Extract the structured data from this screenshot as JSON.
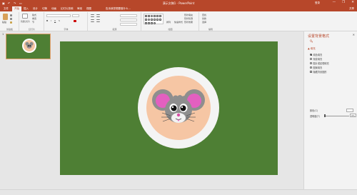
{
  "window": {
    "title": "演示文稿1 - PowerPoint",
    "signin": "登录",
    "minimize": "—",
    "restore": "❐",
    "close": "✕",
    "quick_access": [
      "save-icon",
      "undo-icon",
      "redo-icon",
      "present-icon"
    ]
  },
  "tabs": [
    {
      "label": "文件",
      "active": false
    },
    {
      "label": "开始",
      "active": true
    },
    {
      "label": "插入",
      "active": false
    },
    {
      "label": "设计",
      "active": false
    },
    {
      "label": "切换",
      "active": false
    },
    {
      "label": "动画",
      "active": false
    },
    {
      "label": "幻灯片放映",
      "active": false
    },
    {
      "label": "审阅",
      "active": false
    },
    {
      "label": "视图",
      "active": false
    }
  ],
  "tell_me": "告诉我您想要做什么...",
  "share": "共享",
  "ribbon": {
    "groups": [
      {
        "label": "剪贴板"
      },
      {
        "label": "幻灯片"
      },
      {
        "label": "字体"
      },
      {
        "label": "段落"
      },
      {
        "label": "绘图"
      },
      {
        "label": "编辑"
      }
    ],
    "paste": "粘贴",
    "new_slide": "新建幻灯片",
    "layout": "版式",
    "reset": "重置",
    "section": "节",
    "arrange": "排列",
    "quick_styles": "快速样式",
    "shape_fill": "形状填充",
    "shape_outline": "形状轮廓",
    "shape_effects": "形状效果",
    "find": "查找",
    "replace": "替换",
    "select": "选择"
  },
  "thumbnails": [
    {
      "number": "1",
      "selected": true
    }
  ],
  "format_pane": {
    "title": "设置背景格式",
    "close": "✕",
    "section": "▲ 填充",
    "options": [
      {
        "label": "纯色填充",
        "selected": true
      },
      {
        "label": "渐变填充",
        "selected": false
      },
      {
        "label": "图片或纹理填充",
        "selected": false
      },
      {
        "label": "图案填充",
        "selected": false
      },
      {
        "label": "隐藏背景图形",
        "selected": false
      }
    ],
    "color_label": "颜色(C)",
    "transparency_label": "透明度(T)",
    "transparency_value": "0%",
    "transparency": 0
  },
  "slide": {
    "background_color": "#4e7f34"
  },
  "colors": {
    "accent": "#b7472a",
    "slide_green": "#4e7f34",
    "plate_white": "#f4f4f4",
    "plate_peach": "#f6c6a4"
  }
}
